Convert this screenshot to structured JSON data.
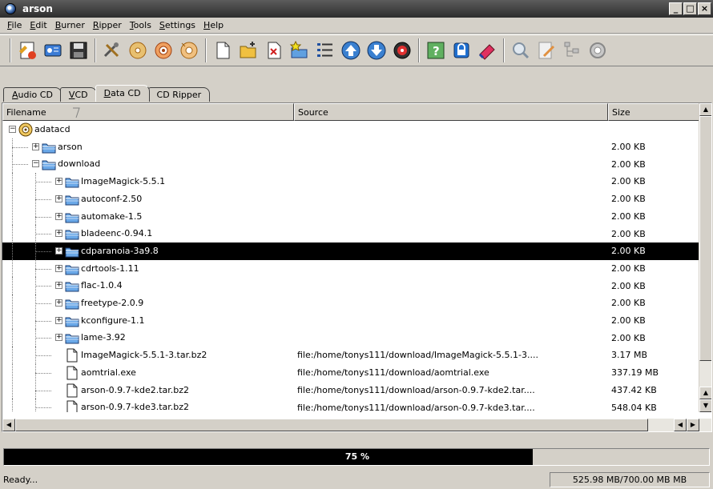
{
  "window": {
    "title": "arson"
  },
  "menu": [
    {
      "acc": "F",
      "rest": "ile"
    },
    {
      "acc": "E",
      "rest": "dit"
    },
    {
      "acc": "B",
      "rest": "urner"
    },
    {
      "acc": "R",
      "rest": "ipper"
    },
    {
      "acc": "T",
      "rest": "ools"
    },
    {
      "acc": "S",
      "rest": "ettings"
    },
    {
      "acc": "H",
      "rest": "elp"
    }
  ],
  "toolbar_groups": [
    [
      "new-project-icon",
      "properties-icon",
      "save-icon"
    ],
    [
      "tools-icon",
      "burn-cd-icon",
      "burn-disc-icon",
      "copy-disc-icon"
    ],
    [
      "new-file-icon",
      "open-folder-icon",
      "remove-file-icon",
      "star-folder-icon",
      "list-icon",
      "move-up-icon",
      "move-down-icon",
      "disc-write-icon"
    ],
    [
      "help-icon",
      "lock-icon",
      "eraser-icon"
    ],
    [
      "search-icon",
      "edit-icon",
      "tree-icon",
      "settings-icon"
    ]
  ],
  "tabs": [
    {
      "acc": "A",
      "rest": "udio CD",
      "active": false
    },
    {
      "acc": "V",
      "rest": "CD",
      "active": false
    },
    {
      "acc": "D",
      "rest": "ata CD",
      "active": true
    },
    {
      "acc": "",
      "rest": "CD Ripper",
      "active": false
    }
  ],
  "columns": {
    "filename": "Filename",
    "source": "Source",
    "size": "Size"
  },
  "rows": [
    {
      "depth": 0,
      "type": "disc",
      "expander": "−",
      "name": "adatacd",
      "source": "",
      "size": ""
    },
    {
      "depth": 1,
      "type": "folder",
      "expander": "+",
      "name": "arson",
      "source": "",
      "size": "2.00 KB"
    },
    {
      "depth": 1,
      "type": "folder",
      "expander": "−",
      "name": "download",
      "source": "",
      "size": "2.00 KB"
    },
    {
      "depth": 2,
      "type": "folder",
      "expander": "+",
      "name": "ImageMagick-5.5.1",
      "source": "",
      "size": "2.00 KB"
    },
    {
      "depth": 2,
      "type": "folder",
      "expander": "+",
      "name": "autoconf-2.50",
      "source": "",
      "size": "2.00 KB"
    },
    {
      "depth": 2,
      "type": "folder",
      "expander": "+",
      "name": "automake-1.5",
      "source": "",
      "size": "2.00 KB"
    },
    {
      "depth": 2,
      "type": "folder",
      "expander": "+",
      "name": "bladeenc-0.94.1",
      "source": "",
      "size": "2.00 KB"
    },
    {
      "depth": 2,
      "type": "folder",
      "expander": "+",
      "name": "cdparanoia-3a9.8",
      "source": "",
      "size": "2.00 KB",
      "selected": true
    },
    {
      "depth": 2,
      "type": "folder",
      "expander": "+",
      "name": "cdrtools-1.11",
      "source": "",
      "size": "2.00 KB"
    },
    {
      "depth": 2,
      "type": "folder",
      "expander": "+",
      "name": "flac-1.0.4",
      "source": "",
      "size": "2.00 KB"
    },
    {
      "depth": 2,
      "type": "folder",
      "expander": "+",
      "name": "freetype-2.0.9",
      "source": "",
      "size": "2.00 KB"
    },
    {
      "depth": 2,
      "type": "folder",
      "expander": "+",
      "name": "kconfigure-1.1",
      "source": "",
      "size": "2.00 KB"
    },
    {
      "depth": 2,
      "type": "folder",
      "expander": "+",
      "name": "lame-3.92",
      "source": "",
      "size": "2.00 KB"
    },
    {
      "depth": 2,
      "type": "file",
      "expander": "",
      "name": "ImageMagick-5.5.1-3.tar.bz2",
      "source": "file:/home/tonys111/download/ImageMagick-5.5.1-3....",
      "size": "3.17 MB"
    },
    {
      "depth": 2,
      "type": "file",
      "expander": "",
      "name": "aomtrial.exe",
      "source": "file:/home/tonys111/download/aomtrial.exe",
      "size": "337.19 MB"
    },
    {
      "depth": 2,
      "type": "file",
      "expander": "",
      "name": "arson-0.9.7-kde2.tar.bz2",
      "source": "file:/home/tonys111/download/arson-0.9.7-kde2.tar....",
      "size": "437.42 KB"
    },
    {
      "depth": 2,
      "type": "file",
      "expander": "",
      "name": "arson-0.9.7-kde3.tar.bz2",
      "source": "file:/home/tonys111/download/arson-0.9.7-kde3.tar....",
      "size": "548.04 KB"
    }
  ],
  "progress": {
    "fraction": 0.75,
    "label": "75 %"
  },
  "status": {
    "text": "Ready...",
    "capacity": "525.98 MB/700.00 MB MB"
  }
}
